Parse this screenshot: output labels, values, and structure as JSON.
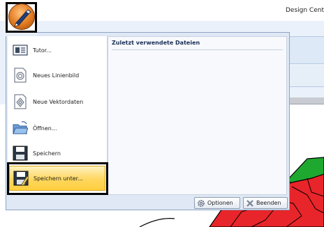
{
  "app": {
    "title": "Design Cent"
  },
  "app_button": {
    "icon": "pen-icon"
  },
  "menu": {
    "items": [
      {
        "label": "Tutor...",
        "icon": "tutorial-icon"
      },
      {
        "label": "Neues Linienbild",
        "icon": "new-line-image-icon"
      },
      {
        "label": "Neue Vektordaten",
        "icon": "new-vector-data-icon"
      },
      {
        "label": "Öffnen...",
        "icon": "open-folder-icon"
      },
      {
        "label": "Speichern",
        "icon": "save-icon"
      },
      {
        "label": "Speichern unter...",
        "icon": "save-as-icon"
      }
    ],
    "recent_header": "Zuletzt verwendete Dateien",
    "options_label": "Optionen",
    "exit_label": "Beenden"
  },
  "colors": {
    "highlight": "#ffd75e",
    "design_red": "#e8252a",
    "design_green": "#1fa830"
  }
}
